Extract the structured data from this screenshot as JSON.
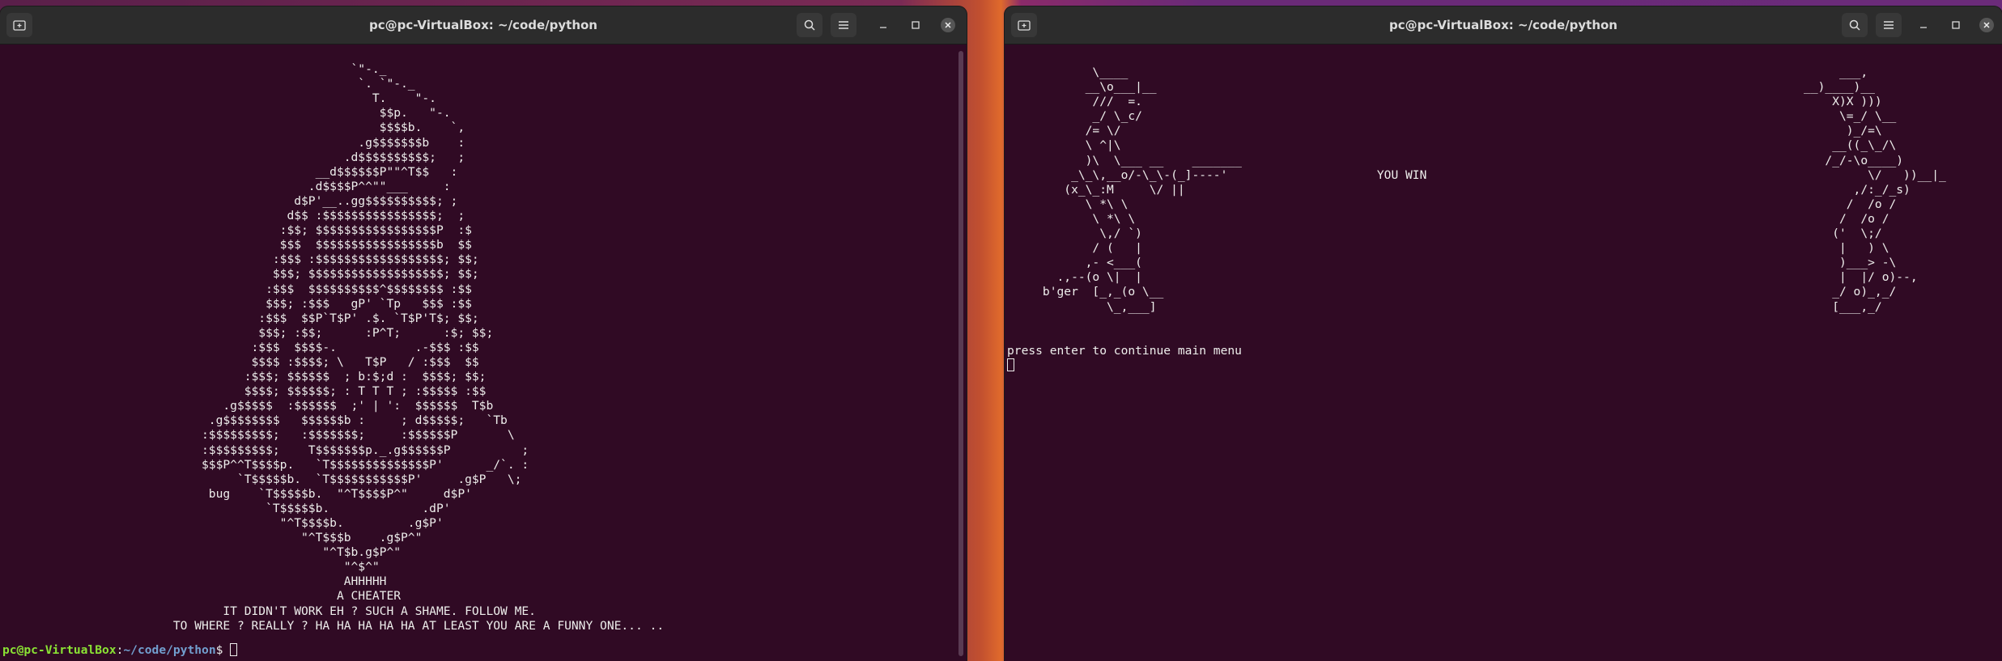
{
  "left_window": {
    "title": "pc@pc-VirtualBox: ~/code/python",
    "ascii_lines": [
      "                                                 `\"-._",
      "                                                  `. `\"-._",
      "                                                    T.    \"-.",
      "                                                     $$p.   \"-.",
      "                                                     $$$$b.    `,",
      "                                                  .g$$$$$$$b    :",
      "                                                .d$$$$$$$$$$;   ;",
      "                                            __d$$$$$$P\"\"^T$$   :",
      "                                           .d$$$$P^^\"\"___     :",
      "                                         d$P'__..gg$$$$$$$$$$; ;",
      "                                        d$$ :$$$$$$$$$$$$$$$$;  ;",
      "                                       :$$; $$$$$$$$$$$$$$$$$P  :$",
      "                                       $$$  $$$$$$$$$$$$$$$$$b  $$",
      "                                      :$$$ :$$$$$$$$$$$$$$$$$$; $$;",
      "                                      $$$; $$$$$$$$$$$$$$$$$$$; $$;",
      "                                     :$$$  $$$$$$$$$$^$$$$$$$$ :$$",
      "                                     $$$; :$$$   gP' `Tp   $$$ :$$",
      "                                    :$$$  $$P`T$P' .$. `T$P'T$; $$;",
      "                                    $$$; :$$;      :P^T;      :$; $$;",
      "                                   :$$$  $$$$-.           .-$$$ :$$",
      "                                   $$$$ :$$$$; \\   T$P   / :$$$  $$",
      "                                  :$$$; $$$$$$  ; b:$;d :  $$$$; $$;",
      "                                  $$$$; $$$$$$; : T T T ; :$$$$$ :$$",
      "                               .g$$$$$  :$$$$$$  ;' | ':  $$$$$$  T$b",
      "                             .g$$$$$$$$   $$$$$$b :     ; d$$$$$;   `Tb",
      "                            :$$$$$$$$$;   :$$$$$$$;     :$$$$$$P       \\",
      "                            :$$$$$$$$$;    T$$$$$$$p._.g$$$$$$P          ;",
      "                            $$$P^^T$$$$p.   `T$$$$$$$$$$$$$$P'      _/`. :",
      "                                 `T$$$$$b.  `T$$$$$$$$$$$P'     .g$P   \\;",
      "                             bug    `T$$$$$b.  \"^T$$$$P^\"     d$P'",
      "                                     `T$$$$$b.             .dP'",
      "                                       \"^T$$$$b.         .g$P'",
      "                                          \"^T$$$b    .g$P^\"",
      "                                             \"^T$b.g$P^\"",
      "                                                \"^$^\"",
      "                                                AHHHHH",
      "                                               A CHEATER",
      "                               IT DIDN'T WORK EH ? SUCH A SHAME. FOLLOW ME.",
      "                        TO WHERE ? REALLY ? HA HA HA HA HA AT LEAST YOU ARE A FUNNY ONE... .."
    ],
    "prompt_user": "pc@pc-VirtualBox",
    "prompt_sep": ":",
    "prompt_path": "~/code/python",
    "prompt_end": "$ "
  },
  "right_window": {
    "title": "pc@pc-VirtualBox: ~/code/python",
    "ascii_lines": [
      "            \\____                                                                                                    ___,",
      "           __\\o___|__                                                                                           __)____)__",
      "            ///  =.                                                                                                 X)X )))",
      "            _/ \\_c/                                                                                                  \\=_/ \\__",
      "           /= \\/                                                                                                      )_/=\\",
      "           \\ ^|\\                                                                                                    __((_\\_/\\",
      "           )\\  \\___ __    _______                                                                                  /_/-\\o____)",
      "         _\\_\\,__o/-\\_\\-(_]----'                     YOU WIN                                                              \\/   ))__|_",
      "        (x_\\_:M     \\/ ||                                                                                              ,/:_/_s)",
      "           \\ *\\ \\                                                                                                     /  /o /",
      "            \\ *\\ \\                                                                                                   /  /o /",
      "             \\,/ `)                                                                                                 ('  \\;/",
      "            / (   |                                                                                                  |   ) \\",
      "           ,- <___(                                                                                                  )___> -\\",
      "       .,--(o \\|  |                                                                                                  |  |/ o)--,",
      "     b'ger  [_,_(o \\__                                                                                              _/ o)_,_/",
      "              \\_,___]                                                                                               [___,_/",
      "",
      "",
      "press enter to continue main menu"
    ]
  }
}
